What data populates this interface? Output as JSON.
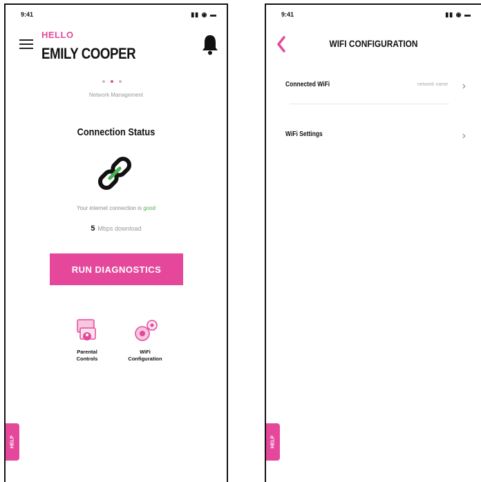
{
  "status_bar": {
    "time": "9:41",
    "icons": "▮▮ ◉ ▬"
  },
  "left_screen": {
    "greeting": "HELLO",
    "user_name": "EMILY COOPER",
    "page_indicator": {
      "count": 3,
      "active": 2
    },
    "section_subtitle": "Network Management",
    "connection_title": "Connection Status",
    "connection_message_prefix": "Your internet connection is",
    "connection_message_status": "good",
    "speed_value": "5",
    "speed_unit": "Mbps download",
    "cta_label": "RUN DIAGNOSTICS",
    "tiles": [
      {
        "label": "Parental\nControls",
        "icon": "parental-controls-icon"
      },
      {
        "label": "WiFi\nConfiguration",
        "icon": "wifi-configuration-icon"
      }
    ],
    "side_tab_label": "HELP"
  },
  "right_screen": {
    "title": "WIFI CONFIGURATION",
    "rows": [
      {
        "label": "Connected WiFi",
        "value": "network name"
      },
      {
        "label": "WiFi Settings",
        "value": ""
      }
    ],
    "side_tab_label": "HELP"
  },
  "colors": {
    "accent": "#e5489b",
    "good": "#4caf50",
    "text": "#111111"
  }
}
